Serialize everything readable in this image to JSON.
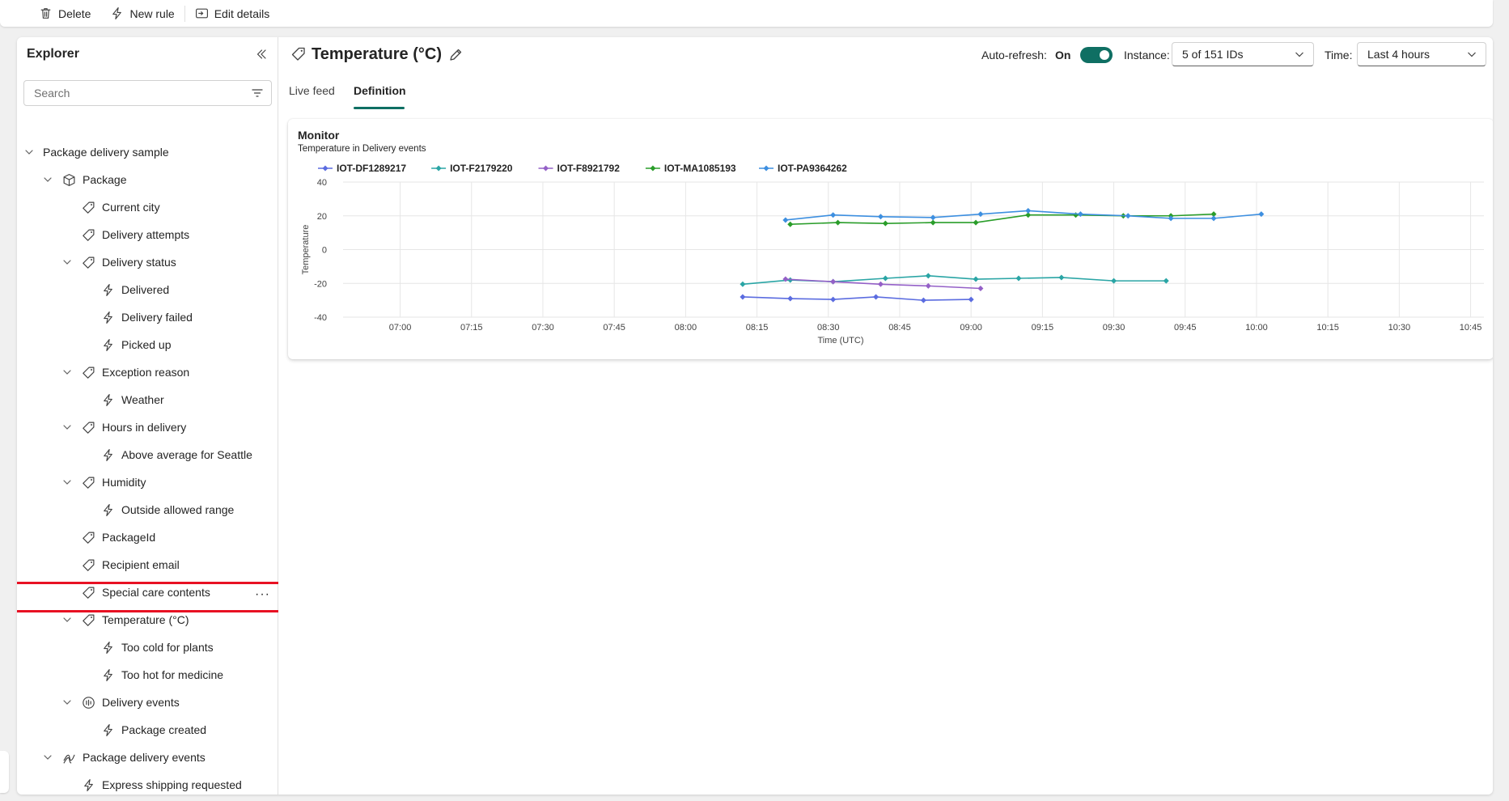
{
  "toolbar": {
    "delete_label": "Delete",
    "new_rule_label": "New rule",
    "edit_details_label": "Edit details"
  },
  "explorer": {
    "title": "Explorer",
    "search_placeholder": "Search",
    "items": [
      {
        "label": "Package delivery sample",
        "level": 0,
        "expander": "expanded",
        "icon": "none"
      },
      {
        "label": "Package",
        "level": 1,
        "expander": "expanded",
        "icon": "cube-icon"
      },
      {
        "label": "Current city",
        "level": 2,
        "expander": "none",
        "icon": "tag-icon"
      },
      {
        "label": "Delivery attempts",
        "level": 2,
        "expander": "none",
        "icon": "tag-icon"
      },
      {
        "label": "Delivery status",
        "level": 2,
        "expander": "expanded",
        "icon": "tag-icon"
      },
      {
        "label": "Delivered",
        "level": 3,
        "expander": "none",
        "icon": "lightning-icon"
      },
      {
        "label": "Delivery failed",
        "level": 3,
        "expander": "none",
        "icon": "lightning-icon"
      },
      {
        "label": "Picked up",
        "level": 3,
        "expander": "none",
        "icon": "lightning-icon"
      },
      {
        "label": "Exception reason",
        "level": 2,
        "expander": "expanded",
        "icon": "tag-icon"
      },
      {
        "label": "Weather",
        "level": 3,
        "expander": "none",
        "icon": "lightning-icon"
      },
      {
        "label": "Hours in delivery",
        "level": 2,
        "expander": "expanded",
        "icon": "tag-icon"
      },
      {
        "label": "Above average for Seattle",
        "level": 3,
        "expander": "none",
        "icon": "lightning-icon"
      },
      {
        "label": "Humidity",
        "level": 2,
        "expander": "expanded",
        "icon": "tag-icon"
      },
      {
        "label": "Outside allowed range",
        "level": 3,
        "expander": "none",
        "icon": "lightning-icon"
      },
      {
        "label": "PackageId",
        "level": 2,
        "expander": "none",
        "icon": "tag-icon"
      },
      {
        "label": "Recipient email",
        "level": 2,
        "expander": "none",
        "icon": "tag-icon"
      },
      {
        "label": "Special care contents",
        "level": 2,
        "expander": "none",
        "icon": "tag-icon"
      },
      {
        "label": "Temperature (°C)",
        "level": 2,
        "expander": "expanded",
        "icon": "tag-icon",
        "selected": true
      },
      {
        "label": "Too cold for plants",
        "level": 3,
        "expander": "none",
        "icon": "lightning-icon"
      },
      {
        "label": "Too hot for medicine",
        "level": 3,
        "expander": "none",
        "icon": "lightning-icon"
      },
      {
        "label": "Delivery events",
        "level": 2,
        "expander": "expanded",
        "icon": "event-icon"
      },
      {
        "label": "Package created",
        "level": 3,
        "expander": "none",
        "icon": "lightning-icon"
      },
      {
        "label": "Package delivery events",
        "level": 1,
        "expander": "expanded",
        "icon": "stream-icon"
      },
      {
        "label": "Express shipping requested",
        "level": 2,
        "expander": "none",
        "icon": "lightning-icon"
      }
    ]
  },
  "header": {
    "title": "Temperature (°C)",
    "auto_refresh_label": "Auto-refresh:",
    "auto_refresh_value": "On",
    "instance_label": "Instance:",
    "instance_value": "5 of 151 IDs",
    "time_label": "Time:",
    "time_value": "Last 4 hours"
  },
  "tabs": [
    {
      "label": "Live feed",
      "active": false
    },
    {
      "label": "Definition",
      "active": true
    }
  ],
  "card": {
    "title": "Monitor",
    "subtitle": "Temperature in Delivery events"
  },
  "colors": {
    "accent": "#0f6f63",
    "selection_outline": "#e81123"
  },
  "chart_data": {
    "type": "line",
    "xlabel": "Time (UTC)",
    "ylabel": "Temperature",
    "ylim": [
      -40,
      40
    ],
    "yticks": [
      40,
      20,
      0,
      -20,
      -40
    ],
    "xticks": [
      "07:00",
      "07:15",
      "07:30",
      "07:45",
      "08:00",
      "08:15",
      "08:30",
      "08:45",
      "09:00",
      "09:15",
      "09:30",
      "09:45",
      "10:00",
      "10:15",
      "10:30",
      "10:45"
    ],
    "grid": true,
    "legend_position": "top-left",
    "series": [
      {
        "name": "IOT-DF1289217",
        "color": "#5b6ce0",
        "points": [
          [
            "08:12",
            -28
          ],
          [
            "08:22",
            -29
          ],
          [
            "08:31",
            -29.5
          ],
          [
            "08:40",
            -28
          ],
          [
            "08:50",
            -30
          ],
          [
            "09:00",
            -29.5
          ]
        ]
      },
      {
        "name": "IOT-F2179220",
        "color": "#2aa5a5",
        "points": [
          [
            "08:12",
            -20.5
          ],
          [
            "08:22",
            -18
          ],
          [
            "08:31",
            -19
          ],
          [
            "08:42",
            -17
          ],
          [
            "08:51",
            -15.5
          ],
          [
            "09:01",
            -17.5
          ],
          [
            "09:10",
            -17
          ],
          [
            "09:19",
            -16.5
          ],
          [
            "09:30",
            -18.5
          ],
          [
            "09:41",
            -18.5
          ]
        ]
      },
      {
        "name": "IOT-F8921792",
        "color": "#9460c7",
        "points": [
          [
            "08:21",
            -17.5
          ],
          [
            "08:31",
            -19
          ],
          [
            "08:41",
            -20.5
          ],
          [
            "08:51",
            -21.5
          ],
          [
            "09:02",
            -23
          ]
        ]
      },
      {
        "name": "IOT-MA1085193",
        "color": "#2a9d2a",
        "points": [
          [
            "08:22",
            15
          ],
          [
            "08:32",
            16
          ],
          [
            "08:42",
            15.5
          ],
          [
            "08:52",
            16
          ],
          [
            "09:01",
            16
          ],
          [
            "09:12",
            20.5
          ],
          [
            "09:22",
            20.5
          ],
          [
            "09:32",
            20
          ],
          [
            "09:42",
            20
          ],
          [
            "09:51",
            21
          ]
        ]
      },
      {
        "name": "IOT-PA9364262",
        "color": "#3d8fe0",
        "points": [
          [
            "08:21",
            17.5
          ],
          [
            "08:31",
            20.5
          ],
          [
            "08:41",
            19.5
          ],
          [
            "08:52",
            19
          ],
          [
            "09:02",
            21
          ],
          [
            "09:12",
            23
          ],
          [
            "09:23",
            21
          ],
          [
            "09:33",
            20
          ],
          [
            "09:42",
            18.5
          ],
          [
            "09:51",
            18.5
          ],
          [
            "10:01",
            21
          ]
        ]
      }
    ]
  }
}
